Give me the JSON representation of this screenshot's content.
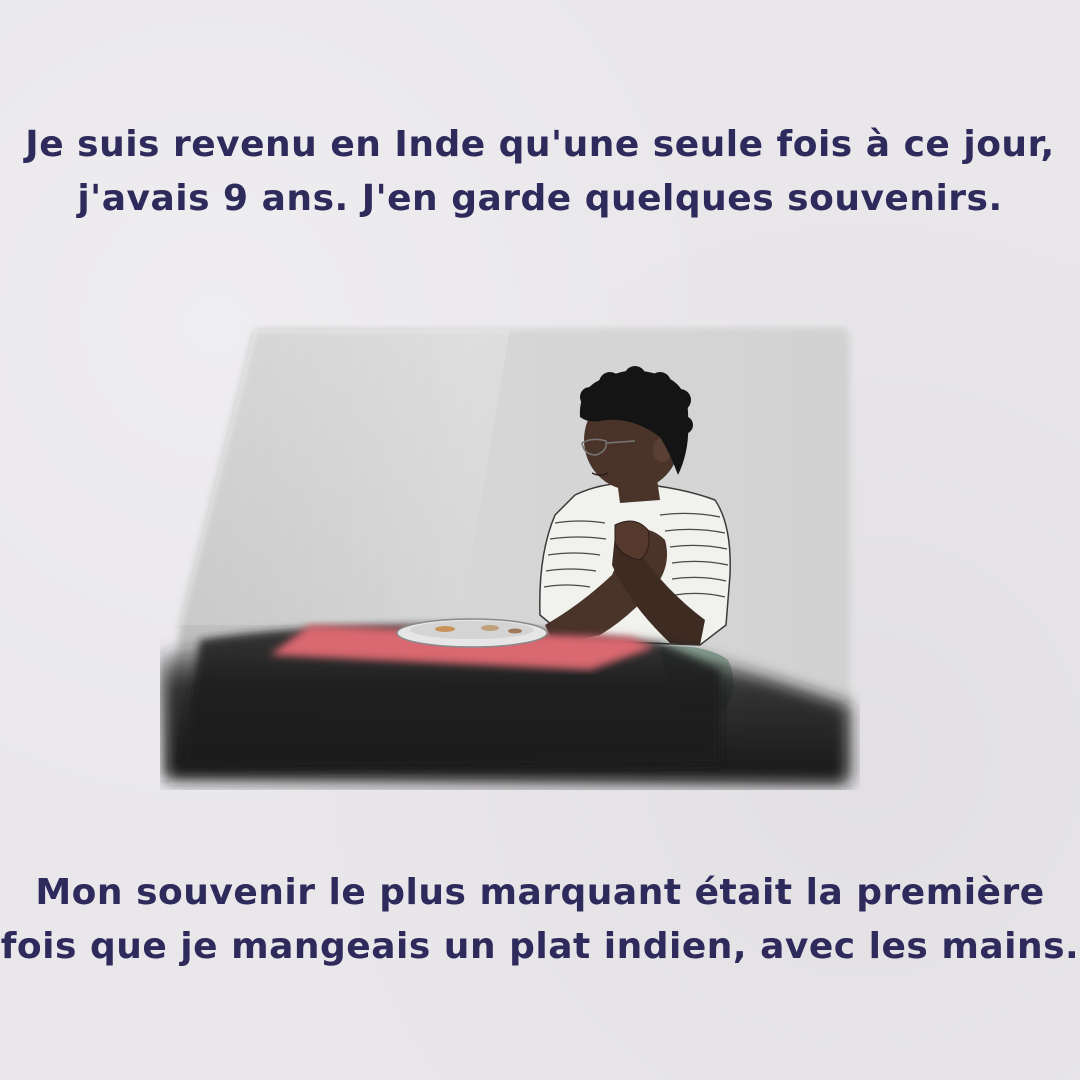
{
  "caption_top": {
    "line1": "Je suis revenu en Inde qu'une seule fois à ce jour,",
    "line2": "j'avais 9 ans. J'en garde quelques souvenirs."
  },
  "caption_bottom": {
    "line1": "Mon souvenir le plus marquant était la première",
    "line2": "fois que je mangeais un plat indien, avec les mains."
  },
  "colors": {
    "text": "#2e2a5c",
    "background": "#e9e7ea",
    "wall": "#cfcfcf",
    "table_top": "#1c1c1c",
    "placemat": "#d9676f",
    "skin": "#4a342a",
    "hair": "#141414",
    "shirt": "#f1f1ee",
    "shorts": "#8fa79a"
  }
}
